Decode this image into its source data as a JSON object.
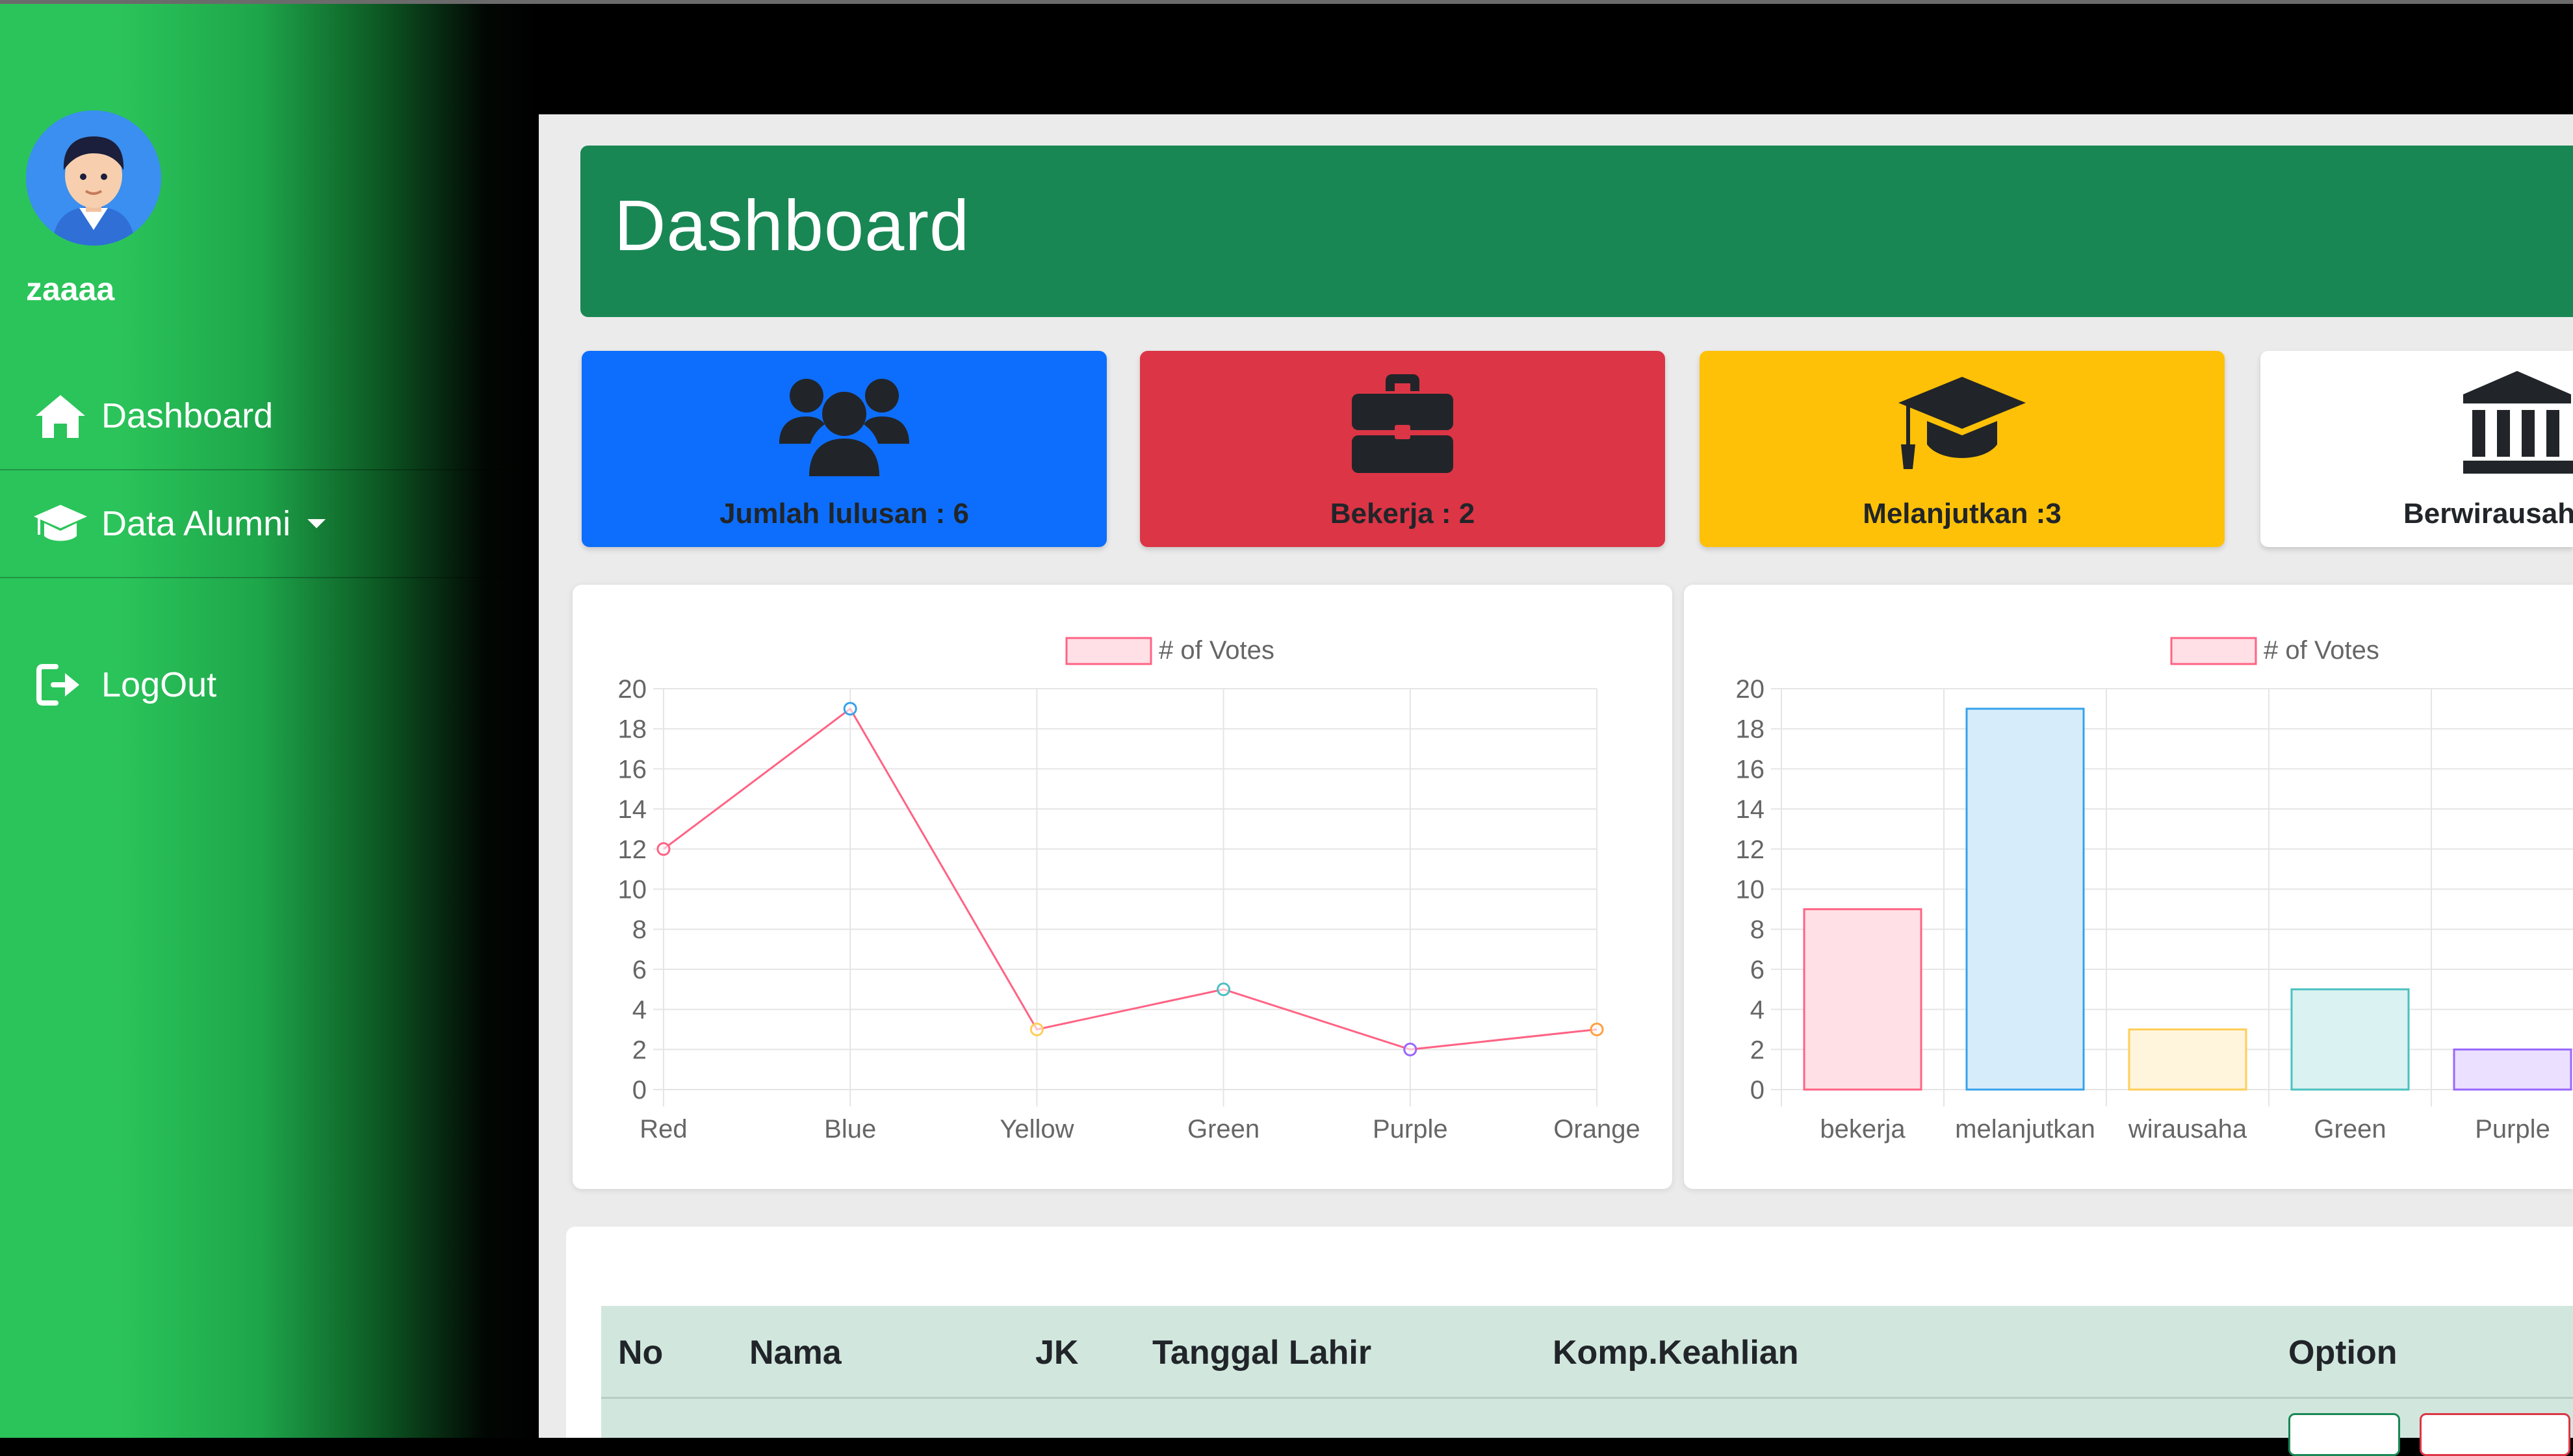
{
  "user": {
    "name": "zaaaa"
  },
  "nav": {
    "items": [
      {
        "label": "Dashboard",
        "icon": "home-icon"
      },
      {
        "label": "Data Alumni",
        "icon": "graduation-cap-icon"
      },
      {
        "label": "LogOut",
        "icon": "logout-icon"
      }
    ]
  },
  "header": {
    "title": "Dashboard"
  },
  "cards": [
    {
      "label": "Jumlah lulusan : 6",
      "color": "#0d6efd",
      "icon": "users-icon"
    },
    {
      "label": "Bekerja : 2",
      "color": "#dc3545",
      "icon": "briefcase-icon"
    },
    {
      "label": "Melanjutkan :3",
      "color": "#ffc107",
      "icon": "graduation-cap-icon"
    },
    {
      "label": "Berwirausah",
      "color": "#ffffff",
      "icon": "institution-icon"
    }
  ],
  "chart_data": [
    {
      "type": "line",
      "categories": [
        "Red",
        "Blue",
        "Yellow",
        "Green",
        "Purple",
        "Orange"
      ],
      "series": [
        {
          "name": "# of Votes",
          "values": [
            12,
            19,
            3,
            5,
            2,
            3
          ]
        }
      ],
      "ylim": [
        0,
        20
      ],
      "yticks": [
        0,
        2,
        4,
        6,
        8,
        10,
        12,
        14,
        16,
        18,
        20
      ],
      "grid": true,
      "legend": "top-center",
      "line_color": "#ff6384",
      "point_colors": [
        "#ff6384",
        "#36a2eb",
        "#ffce56",
        "#4bc0c0",
        "#9966ff",
        "#ff9f40"
      ]
    },
    {
      "type": "bar",
      "categories": [
        "bekerja",
        "melanjutkan",
        "wirausaha",
        "Green",
        "Purple"
      ],
      "series": [
        {
          "name": "# of Votes",
          "values": [
            9,
            19,
            3,
            5,
            2
          ]
        }
      ],
      "ylim": [
        0,
        20
      ],
      "yticks": [
        0,
        2,
        4,
        6,
        8,
        10,
        12,
        14,
        16,
        18,
        20
      ],
      "grid": true,
      "legend": "top-center",
      "bar_fills": [
        "#ffe0e6",
        "#d7ecfb",
        "#fff5dd",
        "#dbf2f2",
        "#ebe0ff"
      ],
      "bar_borders": [
        "#ff6384",
        "#36a2eb",
        "#ffce56",
        "#4bc0c0",
        "#9966ff"
      ]
    }
  ],
  "table": {
    "headers": [
      "No",
      "Nama",
      "JK",
      "Tanggal Lahir",
      "Komp.Keahlian",
      "Option"
    ]
  }
}
